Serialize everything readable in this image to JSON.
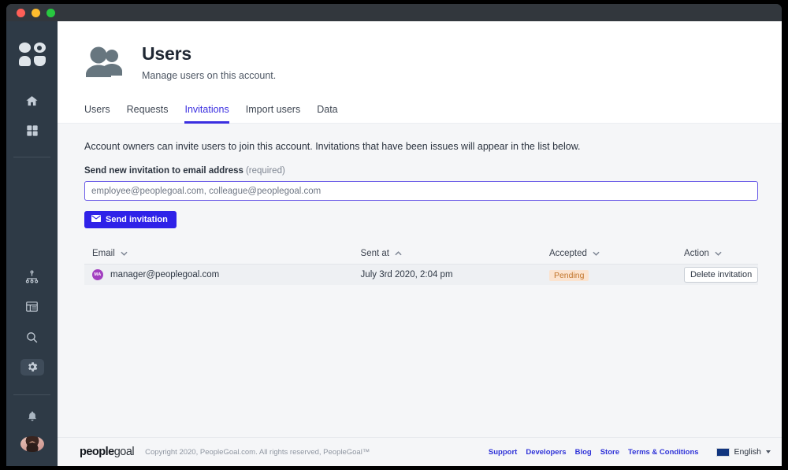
{
  "window": {
    "traffic_lights": [
      "close",
      "minimize",
      "maximize"
    ]
  },
  "sidebar": {
    "logo_name": "peoplegoal-logo-mark",
    "items": [
      {
        "name": "home",
        "icon": "home-icon",
        "active": false
      },
      {
        "name": "apps",
        "icon": "grid-icon",
        "active": false
      },
      {
        "name": "org-chart",
        "icon": "org-chart-icon",
        "active": false
      },
      {
        "name": "table",
        "icon": "table-icon",
        "active": false
      },
      {
        "name": "search",
        "icon": "search-icon",
        "active": false
      },
      {
        "name": "settings",
        "icon": "gear-icon",
        "active": true
      },
      {
        "name": "notifications",
        "icon": "bell-icon",
        "active": false
      }
    ],
    "avatar_alt": "user-profile-photo"
  },
  "header": {
    "icon": "users-icon",
    "title": "Users",
    "subtitle": "Manage users on this account."
  },
  "tabs": [
    {
      "label": "Users",
      "active": false
    },
    {
      "label": "Requests",
      "active": false
    },
    {
      "label": "Invitations",
      "active": true
    },
    {
      "label": "Import users",
      "active": false
    },
    {
      "label": "Data",
      "active": false
    }
  ],
  "main": {
    "intro": "Account owners can invite users to join this account. Invitations that have been issues will appear in the list below.",
    "field_label": "Send new invitation to email address",
    "required_text": "(required)",
    "input_placeholder": "employee@peoplegoal.com, colleague@peoplegoal.com",
    "input_value": "",
    "send_button": "Send invitation",
    "send_button_icon": "envelope-icon"
  },
  "table": {
    "columns": [
      {
        "label": "Email",
        "sort": "down"
      },
      {
        "label": "Sent at",
        "sort": "up"
      },
      {
        "label": "Accepted",
        "sort": "down"
      },
      {
        "label": "Action",
        "sort": "down"
      }
    ],
    "rows": [
      {
        "initials": "MA",
        "email": "manager@peoplegoal.com",
        "sent_at": "July 3rd 2020, 2:04 pm",
        "accepted": "Pending",
        "action": "Delete invitation"
      }
    ]
  },
  "footer": {
    "brand_bold": "people",
    "brand_light": "goal",
    "copyright": "Copyright 2020, PeopleGoal.com. All rights reserved, PeopleGoal™",
    "links": [
      "Support",
      "Developers",
      "Blog",
      "Store",
      "Terms & Conditions"
    ],
    "language": "English",
    "flag": "uk-flag-icon"
  },
  "colors": {
    "accent": "#2f22e8",
    "tab_active": "#3b2fe0",
    "sidebar_bg": "#2e3a46",
    "badge_bg": "#fbe3cf",
    "badge_text": "#c1752c",
    "avatar_bg": "#a23fc0"
  }
}
